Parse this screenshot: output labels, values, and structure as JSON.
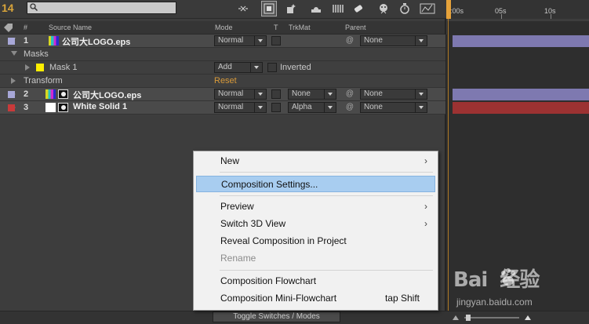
{
  "toolbar": {
    "frame_number": "14",
    "search_value": "",
    "icons": [
      "search-icon",
      "draft-3d-icon",
      "comp-mini-flowchart-icon",
      "live-update-icon",
      "frame-blending-icon",
      "motion-blur-icon",
      "brainstorm-icon",
      "graph-editor-icon",
      "shy-icon"
    ]
  },
  "ruler": {
    "labels": [
      "0:00s",
      "05s",
      "10s"
    ]
  },
  "header": {
    "label_col": "#",
    "source_name": "Source Name",
    "mode": "Mode",
    "t": "T",
    "trkmat": "TrkMat",
    "parent": "Parent"
  },
  "layers": [
    {
      "num": "1",
      "name": "公司大LOGO.eps",
      "mode": "Normal",
      "trkmat": "",
      "parent": "None",
      "color": "#a8a8d8",
      "bar_color": "#7e79b0"
    },
    {
      "num": "2",
      "name": "公司大LOGO.eps",
      "mode": "Normal",
      "trkmat": "None",
      "parent": "None",
      "color": "#a8a8d8",
      "bar_color": "#7e79b0"
    },
    {
      "num": "3",
      "name": "White Solid 1",
      "mode": "Normal",
      "trkmat": "Alpha",
      "parent": "None",
      "color": "#c83a3a",
      "bar_color": "#9c3232"
    }
  ],
  "masks": {
    "group_label": "Masks",
    "mask_name": "Mask 1",
    "mask_color": "#ffee00",
    "mask_mode": "Add",
    "inverted_label": "Inverted"
  },
  "transform": {
    "label": "Transform",
    "reset_label": "Reset"
  },
  "context_menu": {
    "items": [
      {
        "label": "New",
        "submenu": true
      },
      {
        "label": "Composition Settings...",
        "highlighted": true
      },
      {
        "label": "Preview",
        "submenu": true
      },
      {
        "label": "Switch 3D View",
        "submenu": true
      },
      {
        "label": "Reveal Composition in Project"
      },
      {
        "label": "Rename",
        "disabled": true
      },
      {
        "label": "Composition Flowchart"
      },
      {
        "label": "Composition Mini-Flowchart",
        "shortcut": "tap Shift"
      }
    ]
  },
  "bottom": {
    "toggle_label": "Toggle Switches / Modes"
  },
  "watermark": {
    "logo": "Bai  经验",
    "url": "jingyan.baidu.com"
  }
}
